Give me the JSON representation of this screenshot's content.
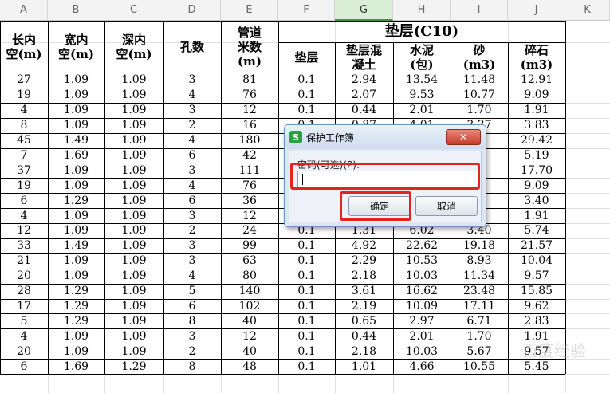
{
  "columns": [
    "A",
    "B",
    "C",
    "D",
    "E",
    "F",
    "G",
    "H",
    "I",
    "J",
    "K"
  ],
  "selected_column": "G",
  "headers": {
    "A": "长内\n空(m)",
    "B": "宽内\n空(m)",
    "C": "深内\n空(m)",
    "D": "孔数",
    "E": "管道\n米数\n(m)",
    "group": "垫层(C10)",
    "F": "垫层",
    "G": "垫层混\n凝土",
    "H": "水泥\n(包)",
    "I": "砂\n(m3)",
    "J": "碎石\n(m3)"
  },
  "rows": [
    [
      "27",
      "1.09",
      "1.09",
      "3",
      "81",
      "0.1",
      "2.94",
      "13.54",
      "11.48",
      "12.91"
    ],
    [
      "19",
      "1.09",
      "1.09",
      "4",
      "76",
      "0.1",
      "2.07",
      "9.53",
      "10.77",
      "9.09"
    ],
    [
      "4",
      "1.09",
      "1.09",
      "3",
      "12",
      "0.1",
      "0.44",
      "2.01",
      "1.70",
      "1.91"
    ],
    [
      "8",
      "1.09",
      "1.09",
      "2",
      "16",
      "0.1",
      "0.87",
      "4.01",
      "3.37",
      "3.83"
    ],
    [
      "45",
      "1.49",
      "1.09",
      "4",
      "180",
      "0.1",
      "",
      "",
      "",
      "29.42"
    ],
    [
      "7",
      "1.69",
      "1.09",
      "6",
      "42",
      "0.1",
      "",
      "",
      "",
      "5.19"
    ],
    [
      "37",
      "1.09",
      "1.09",
      "3",
      "111",
      "0.1",
      "",
      "",
      "",
      "17.70"
    ],
    [
      "19",
      "1.09",
      "1.09",
      "4",
      "76",
      "0.1",
      "",
      "",
      "",
      "9.09"
    ],
    [
      "6",
      "1.29",
      "1.09",
      "6",
      "36",
      "0.1",
      "",
      "",
      "",
      "3.40"
    ],
    [
      "4",
      "1.09",
      "1.09",
      "3",
      "12",
      "0.1",
      "",
      "",
      "",
      "1.91"
    ],
    [
      "12",
      "1.09",
      "1.09",
      "2",
      "24",
      "0.1",
      "1.31",
      "6.02",
      "3.40",
      "5.74"
    ],
    [
      "33",
      "1.49",
      "1.09",
      "3",
      "99",
      "0.1",
      "4.92",
      "22.62",
      "19.18",
      "21.57"
    ],
    [
      "21",
      "1.09",
      "1.09",
      "3",
      "63",
      "0.1",
      "2.29",
      "10.53",
      "8.93",
      "10.04"
    ],
    [
      "20",
      "1.09",
      "1.09",
      "4",
      "80",
      "0.1",
      "2.18",
      "10.03",
      "11.34",
      "9.57"
    ],
    [
      "28",
      "1.29",
      "1.09",
      "5",
      "140",
      "0.1",
      "3.61",
      "16.62",
      "23.48",
      "15.85"
    ],
    [
      "17",
      "1.29",
      "1.09",
      "6",
      "102",
      "0.1",
      "2.19",
      "10.09",
      "17.11",
      "9.62"
    ],
    [
      "5",
      "1.29",
      "1.09",
      "8",
      "40",
      "0.1",
      "0.65",
      "2.97",
      "6.71",
      "2.83"
    ],
    [
      "4",
      "1.09",
      "1.09",
      "3",
      "12",
      "0.1",
      "0.44",
      "2.01",
      "1.70",
      "1.91"
    ],
    [
      "20",
      "1.09",
      "1.09",
      "2",
      "40",
      "0.1",
      "2.18",
      "10.03",
      "5.67",
      "9.57"
    ],
    [
      "6",
      "1.69",
      "1.29",
      "8",
      "48",
      "0.1",
      "1.01",
      "4.66",
      "10.55",
      "5.45"
    ]
  ],
  "dialog": {
    "title": "保护工作簿",
    "logo": "S",
    "close_icon": "close-icon",
    "password_label": "密码(可选)(P):",
    "password_value": "",
    "ok_label": "确定",
    "cancel_label": "取消",
    "highlight_color": "#e1251b"
  },
  "watermark": "百度经验"
}
